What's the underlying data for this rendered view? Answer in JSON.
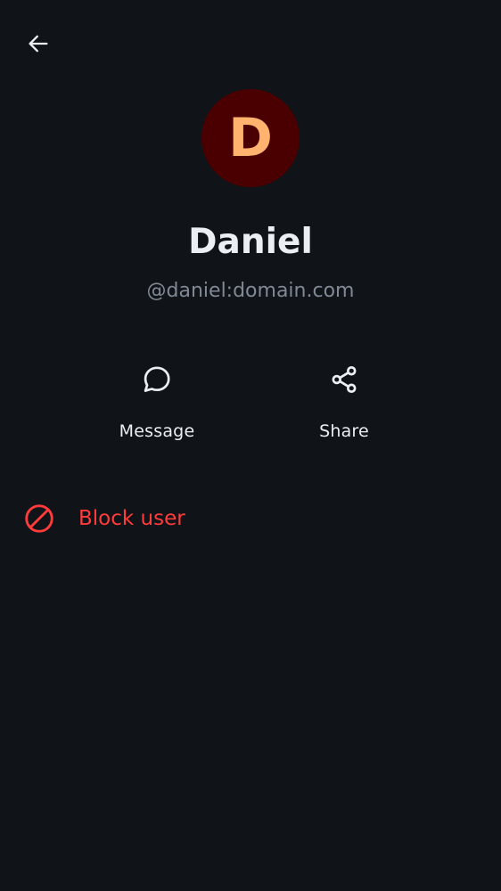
{
  "header": {
    "back_icon": "arrow-left-icon"
  },
  "profile": {
    "avatar_initial": "D",
    "avatar_bg": "#4a0000",
    "avatar_fg": "#ffb36e",
    "display_name": "Daniel",
    "user_id": "@daniel:domain.com"
  },
  "actions": [
    {
      "label": "Message",
      "icon": "chat-bubble-icon"
    },
    {
      "label": "Share",
      "icon": "share-icon"
    }
  ],
  "block": {
    "label": "Block user",
    "icon": "block-icon",
    "color": "#ff3b3b"
  },
  "colors": {
    "background": "#101317",
    "text_primary": "#ebeef2",
    "text_secondary": "#808994"
  }
}
